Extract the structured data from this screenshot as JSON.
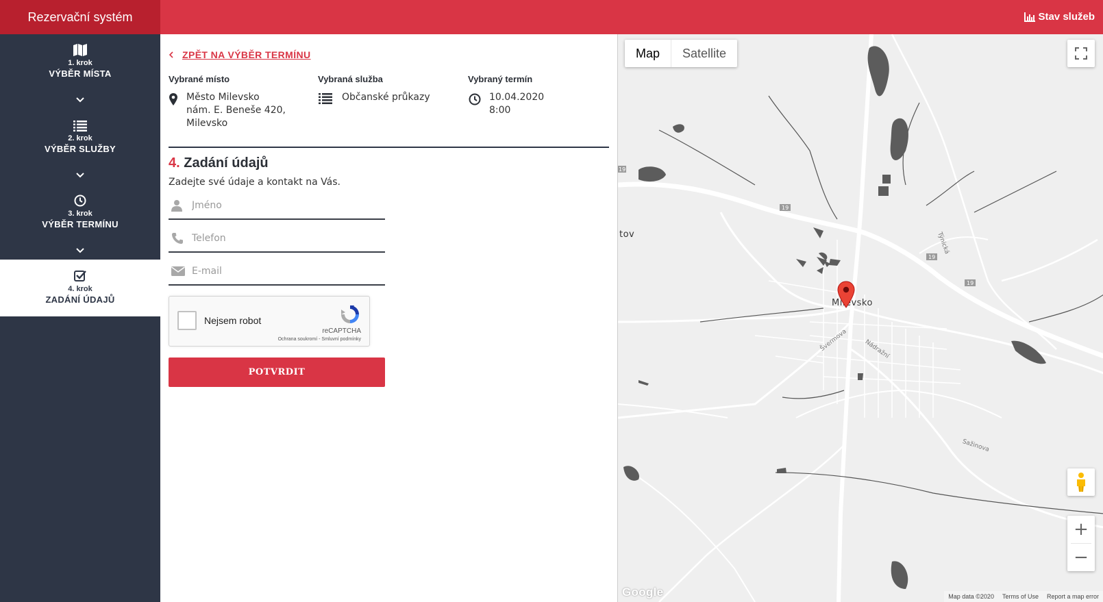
{
  "header": {
    "brand": "Rezervační systém",
    "status_link": "Stav služeb"
  },
  "sidebar": {
    "steps": [
      {
        "num": "1. krok",
        "title": "VÝBĚR MÍSTA",
        "icon": "map-icon",
        "active": false
      },
      {
        "num": "2. krok",
        "title": "VÝBĚR SLUŽBY",
        "icon": "list-icon",
        "active": false
      },
      {
        "num": "3. krok",
        "title": "VÝBĚR TERMÍNU",
        "icon": "clock-icon",
        "active": false
      },
      {
        "num": "4. krok",
        "title": "ZADÁNÍ ÚDAJŮ",
        "icon": "checkbox-icon",
        "active": true
      }
    ]
  },
  "content": {
    "back_link": "ZPĚT NA VÝBĚR TERMÍNU",
    "summary": {
      "place": {
        "head": "Vybrané místo",
        "line1": "Město Milevsko",
        "line2": "nám. E. Beneše 420,",
        "line3": "Milevsko"
      },
      "service": {
        "head": "Vybraná služba",
        "value": "Občanské průkazy"
      },
      "term": {
        "head": "Vybraný termín",
        "date": "10.04.2020",
        "time": "8:00"
      }
    },
    "section": {
      "number": "4.",
      "title": "Zadání údajů",
      "subtitle": "Zadejte své údaje a kontakt na Vás."
    },
    "form": {
      "name_placeholder": "Jméno",
      "phone_placeholder": "Telefon",
      "email_placeholder": "E-mail",
      "name_value": "",
      "phone_value": "",
      "email_value": ""
    },
    "captcha": {
      "label": "Nejsem robot",
      "brand": "reCAPTCHA",
      "legal": "Ochrana soukromí - Smluvní podmínky",
      "checked": false
    },
    "submit_label": "POTVRDIT"
  },
  "map": {
    "type_map": "Map",
    "type_satellite": "Satellite",
    "selected_type": "Map",
    "place_label": "Milevsko",
    "partial_label": "tov",
    "street_labels": [
      "Švermova",
      "Nádražní",
      "Sažinova",
      "Týnická"
    ],
    "road_number": "19",
    "zoom_in": "+",
    "zoom_out": "−",
    "google": "Google",
    "attribution": {
      "data": "Map data ©2020",
      "terms": "Terms of Use",
      "report": "Report a map error"
    },
    "colors": {
      "background": "#efefef",
      "roads": "#ffffff",
      "water": "#5c5c5c",
      "pin": "#ea4335"
    }
  },
  "colors": {
    "accent": "#d93545",
    "brand_dark": "#b8202e",
    "sidebar": "#2e3646"
  }
}
